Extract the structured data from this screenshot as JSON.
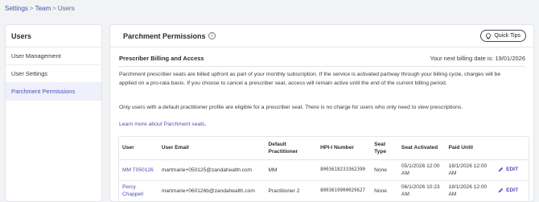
{
  "breadcrumb": {
    "items": [
      "Settings",
      "Team",
      "Users"
    ],
    "separator": ">"
  },
  "sidebar": {
    "title": "Users",
    "items": [
      {
        "label": "User Management",
        "active": false
      },
      {
        "label": "User Settings",
        "active": false
      },
      {
        "label": "Parchment Permissions",
        "active": true
      }
    ]
  },
  "main": {
    "title": "Parchment Permissions",
    "info_icon": "info-icon",
    "quick_tips_label": "Quick Tips",
    "section_heading": "Prescriber Billing and Access",
    "billing_date": "Your next billing date is: 19/01/2026",
    "paragraph1": "Parchment prescriber seats are billed upfront as part of your monthly subscription. If the service is activated partway through your billing cycle, charges will be applied on a pro-rata basis. If you choose to cancel a prescriber seat, access will remain active until the end of the current billing period.",
    "paragraph2": "Only users with a default practitioner profile are eligible for a prescriber seat. There is no charge for users who only need to view prescriptions.",
    "learn_more": "Learn more about Parchment seats."
  },
  "table": {
    "columns": [
      "User",
      "User Email",
      "Default Practitioner",
      "HPI-I Number",
      "Seat Type",
      "Seat Activated",
      "Paid Until",
      ""
    ],
    "rows": [
      {
        "user": "MM T050126",
        "email": "martmarie+050125@zandahealth.com",
        "practitioner": "MM",
        "hpi": "8003618233362390",
        "seat_type": "None",
        "seat_activated": "05/1/2026 12:00 AM",
        "paid_until": "18/1/2026 12:00 AM",
        "action": "EDIT"
      },
      {
        "user": "Percy Chappell",
        "email": "martmarie+060126b@zandahealth.com",
        "practitioner": "Practitioner 2",
        "hpi": "8003619900029627",
        "seat_type": "None",
        "seat_activated": "06/1/2026 10:23 AM",
        "paid_until": "18/1/2026 12:00 AM",
        "action": "EDIT"
      }
    ]
  },
  "colors": {
    "accent": "#4d4fb8",
    "link": "#3f57a6",
    "active_bg": "#eef0fb",
    "page_bg": "#f2f3f5"
  }
}
